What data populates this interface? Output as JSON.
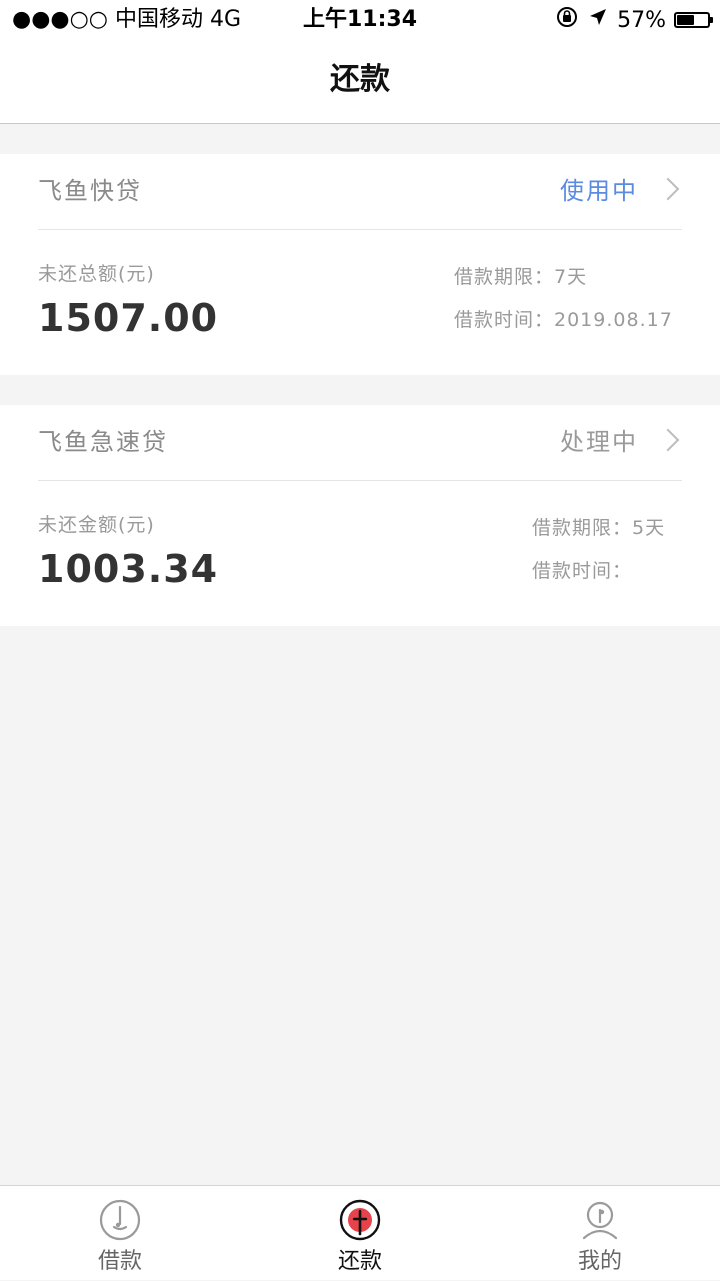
{
  "status_bar": {
    "carrier": "●●●○○ 中国移动   4G",
    "time": "上午11:34",
    "battery_percent": "57%",
    "battery_level": 0.57,
    "icons": [
      "rotation-lock-icon",
      "location-arrow-icon",
      "battery-icon"
    ]
  },
  "nav": {
    "title": "还款"
  },
  "loans": [
    {
      "name": "飞鱼快贷",
      "status": "使用中",
      "status_color": "#5b8be0",
      "amount_label": "未还总额(元)",
      "amount": "1507.00",
      "term": "借款期限：7天",
      "date": "借款时间：2019.08.17"
    },
    {
      "name": "飞鱼急速贷",
      "status": "处理中",
      "status_color": "#9a9a9a",
      "amount_label": "未还金额(元)",
      "amount": "1003.34",
      "term": "借款期限：5天",
      "date": "借款时间："
    }
  ],
  "tabs": [
    {
      "label": "借款",
      "icon": "loan-icon",
      "active": false
    },
    {
      "label": "还款",
      "icon": "repay-icon",
      "active": true
    },
    {
      "label": "我的",
      "icon": "profile-icon",
      "active": false
    }
  ],
  "colors": {
    "accent_red": "#e8424a",
    "background": "#f4f4f4"
  }
}
